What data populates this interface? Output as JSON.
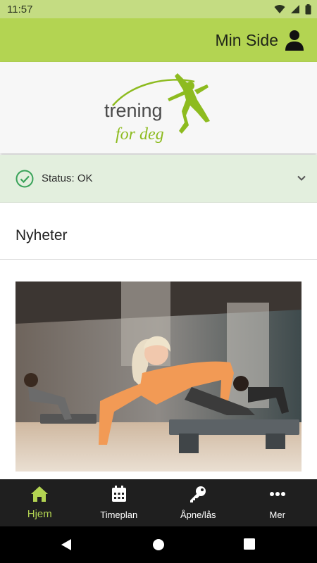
{
  "statusbar": {
    "time": "11:57",
    "icons": [
      "wifi-icon",
      "signal-icon",
      "battery-icon"
    ]
  },
  "header": {
    "title": "Min Side",
    "profile_icon": "person-icon"
  },
  "logo": {
    "line1": "trening",
    "line2": "for deg"
  },
  "status": {
    "text": "Status: OK",
    "icon": "check-circle-icon"
  },
  "news": {
    "title": "Nyheter"
  },
  "bottom_nav": {
    "items": [
      {
        "label": "Hjem",
        "icon": "home-icon",
        "active": true
      },
      {
        "label": "Timeplan",
        "icon": "calendar-icon",
        "active": false
      },
      {
        "label": "Åpne/lås",
        "icon": "key-icon",
        "active": false
      },
      {
        "label": "Mer",
        "icon": "more-icon",
        "active": false
      }
    ]
  },
  "colors": {
    "brand_green": "#b3d452",
    "status_ok": "#3aa35a",
    "nav_bg": "#1f1f1f"
  }
}
